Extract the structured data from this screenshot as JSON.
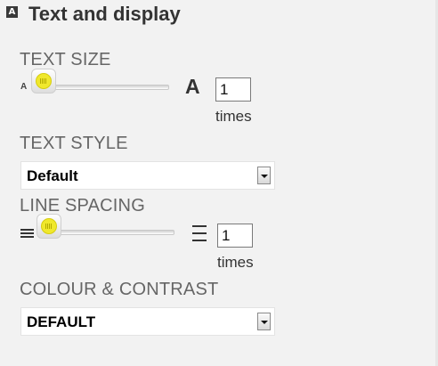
{
  "header": {
    "icon_letter": "A",
    "title": "Text and display"
  },
  "text_size": {
    "label": "TEXT SIZE",
    "small_glyph": "A",
    "large_glyph": "A",
    "value": "1",
    "unit": "times",
    "slider_level": 0
  },
  "text_style": {
    "label": "TEXT STYLE",
    "selected": "Default"
  },
  "line_spacing": {
    "label": "LINE SPACING",
    "value": "1",
    "unit": "times",
    "slider_level": 0
  },
  "colour_contrast": {
    "label": "COLOUR & CONTRAST",
    "selected": "DEFAULT"
  },
  "icons": {
    "header": "text-display-icon",
    "line_spacing_small": "line-spacing-small-icon",
    "line_spacing_large": "line-spacing-large-icon",
    "dropdown": "chevron-down-icon"
  },
  "colors": {
    "background": "#f2f2f2",
    "slider_knob": "#f0e82c",
    "label_text": "#666666"
  }
}
